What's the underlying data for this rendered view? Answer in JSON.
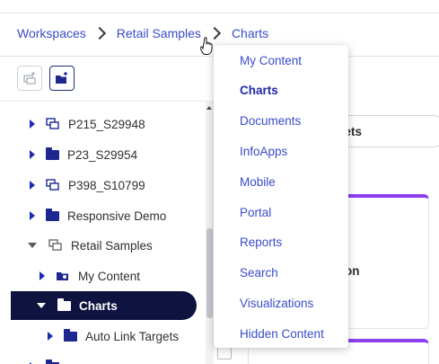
{
  "breadcrumb": {
    "items": [
      "Workspaces",
      "Retail Samples",
      "Charts"
    ]
  },
  "toolbar": {
    "icons": [
      "new-workspace-icon",
      "new-folder-icon"
    ]
  },
  "tree": {
    "rows": [
      {
        "label": "P215_S29948",
        "icon": "workspace-icon"
      },
      {
        "label": "P23_S29954",
        "icon": "folder-icon"
      },
      {
        "label": "P398_S10799",
        "icon": "workspace-icon"
      },
      {
        "label": "Responsive Demo",
        "icon": "folder-icon"
      },
      {
        "label": "Retail Samples",
        "icon": "workspace-icon",
        "expanded": true
      },
      {
        "label": "My Content",
        "icon": "personal-folder-icon"
      },
      {
        "label": "Charts",
        "icon": "folder-icon",
        "selected": true,
        "expanded": true
      },
      {
        "label": "Auto Link Targets",
        "icon": "folder-icon"
      }
    ]
  },
  "menu": {
    "items": [
      "My Content",
      "Charts",
      "Documents",
      "InfoApps",
      "Mobile",
      "Portal",
      "Reports",
      "Search",
      "Visualizations",
      "Hidden Content"
    ],
    "selected": "Charts"
  },
  "background": {
    "pill_text": "rgets",
    "card_text": "gion"
  },
  "colors": {
    "link": "#3a4cc8",
    "selected_row": "#0f1340",
    "folder": "#1d2790",
    "card_accent": "#8b3ff0"
  }
}
